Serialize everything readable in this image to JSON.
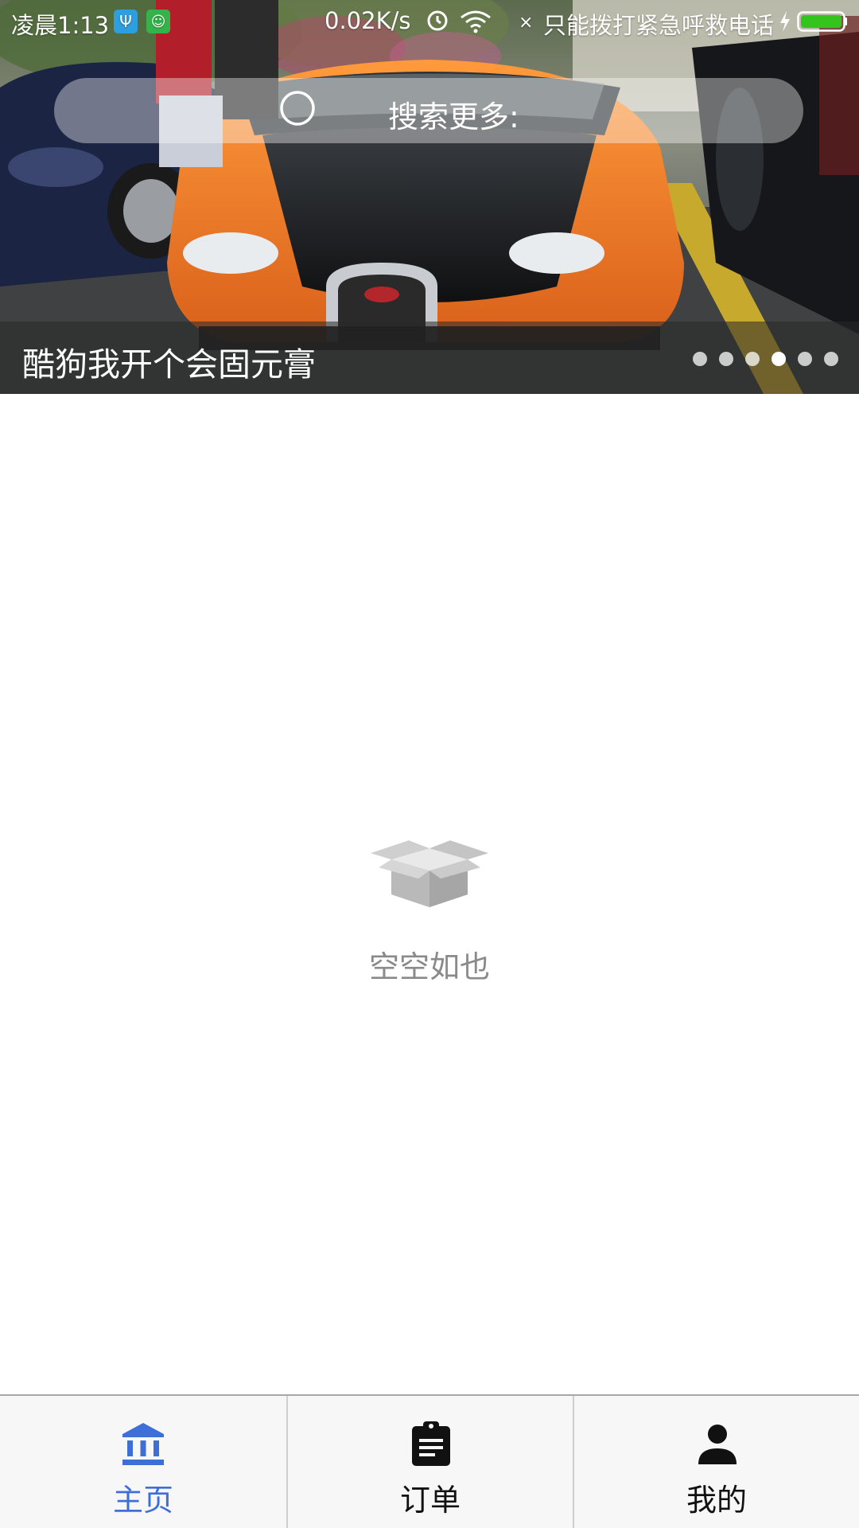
{
  "status_bar": {
    "time": "凌晨1:13",
    "usb_icon": "usb-icon",
    "android_icon": "android-debug-icon",
    "net_speed": "0.02K/s",
    "x_mark": "×",
    "carrier": "只能拨打紧急呼救电话",
    "battery_color": "#35c41e"
  },
  "search": {
    "label": "搜索更多:",
    "icon": "search-icon"
  },
  "banner": {
    "caption": "酷狗我开个会固元膏",
    "slide_count": 6,
    "active_slide": 4
  },
  "empty_state": {
    "icon": "empty-box-icon",
    "text": "空空如也"
  },
  "bottom_nav": {
    "accent_color": "#3e6fd8",
    "tabs": [
      {
        "label": "主页",
        "icon": "bank-icon",
        "active": true
      },
      {
        "label": "订单",
        "icon": "clipboard-icon",
        "active": false
      },
      {
        "label": "我的",
        "icon": "person-icon",
        "active": false
      }
    ]
  }
}
